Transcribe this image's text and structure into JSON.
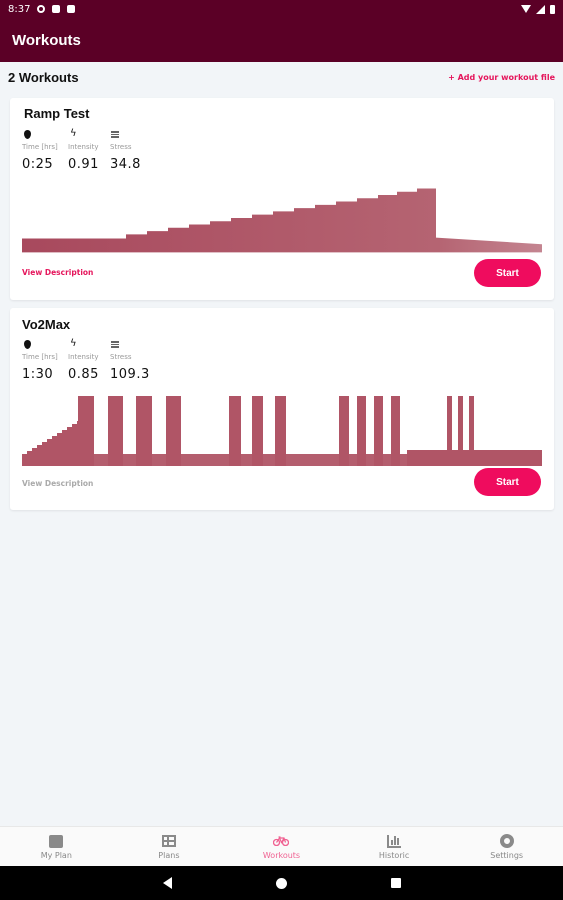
{
  "status_bar": {
    "time": "8:37"
  },
  "app_bar": {
    "title": "Workouts"
  },
  "list_header": {
    "count_label": "2 Workouts",
    "add_link": "+ Add your workout file"
  },
  "workouts": [
    {
      "name": "Ramp Test",
      "stats": [
        {
          "icon": "timer-icon",
          "label": "Time [hrs]",
          "value": "0:25"
        },
        {
          "icon": "bolt-icon",
          "label": "Intensity",
          "value": "0.91"
        },
        {
          "icon": "stress-icon",
          "label": "Stress",
          "value": "34.8"
        }
      ],
      "view_description": "View Description",
      "start_label": "Start"
    },
    {
      "name": "Vo2Max",
      "stats": [
        {
          "icon": "timer-icon",
          "label": "Time [hrs]",
          "value": "1:30"
        },
        {
          "icon": "bolt-icon",
          "label": "Intensity",
          "value": "0.85"
        },
        {
          "icon": "stress-icon",
          "label": "Stress",
          "value": "109.3"
        }
      ],
      "view_description": "View Description",
      "start_label": "Start"
    }
  ],
  "bottom_nav": [
    {
      "label": "My Plan",
      "icon": "calendar-icon",
      "active": false
    },
    {
      "label": "Plans",
      "icon": "table-icon",
      "active": false
    },
    {
      "label": "Workouts",
      "icon": "bike-icon",
      "active": true
    },
    {
      "label": "Historic",
      "icon": "bar-chart-icon",
      "active": false
    },
    {
      "label": "Settings",
      "icon": "gear-icon",
      "active": false
    }
  ],
  "colors": {
    "header": "#5b0026",
    "accent": "#ef0c5e",
    "profile_fill": "#b56472",
    "active_nav": "#f06292"
  }
}
